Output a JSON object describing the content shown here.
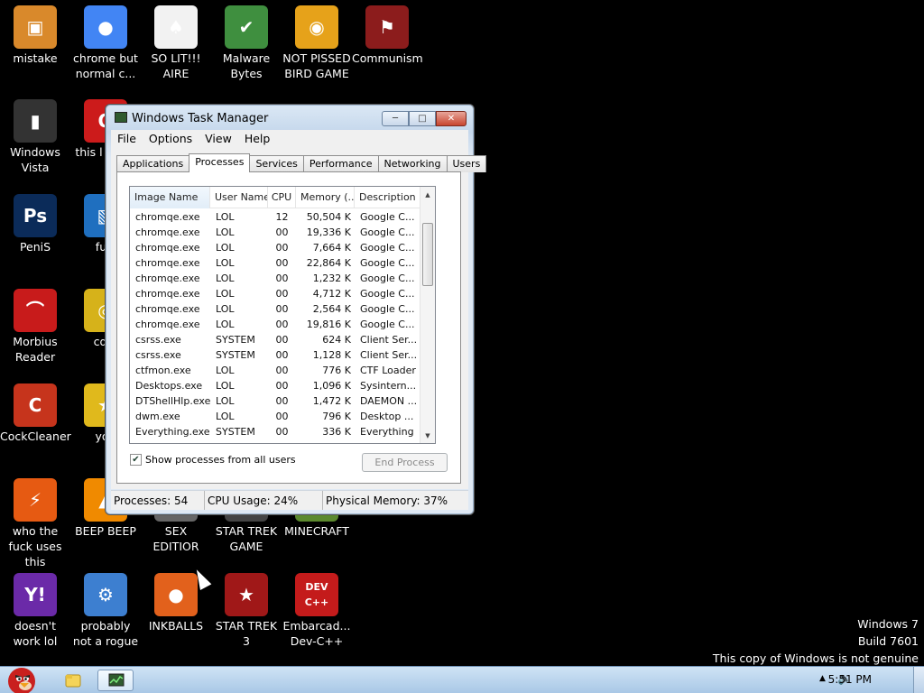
{
  "desktop": {
    "icons": [
      {
        "label": "mistake",
        "icon": "computer-icon",
        "color": "#d9892b",
        "glyph": "▣"
      },
      {
        "label": "chrome but normal c...",
        "icon": "chrome-icon",
        "color": "#4285f4",
        "glyph": "●"
      },
      {
        "label": "SO LIT!!! AIRE",
        "icon": "cards-icon",
        "color": "#f2f2f2",
        "glyph": "♠"
      },
      {
        "label": "Malware Bytes",
        "icon": "shield-icon",
        "color": "#3f8f3f",
        "glyph": "✔"
      },
      {
        "label": "NOT PISSED BIRD GAME",
        "icon": "pig-icon",
        "color": "#e6a21a",
        "glyph": "◉"
      },
      {
        "label": "Communism",
        "icon": "flag-icon",
        "color": "#8c1c1c",
        "glyph": "⚑"
      },
      {
        "label": "Windows Vista",
        "icon": "trash-icon",
        "color": "#333333",
        "glyph": "▮"
      },
      {
        "label": "this l like a",
        "icon": "opera-icon",
        "color": "#cc1b1b",
        "glyph": "O"
      },
      {
        "label": "PeniS",
        "icon": "photoshop-icon",
        "color": "#0b2b59",
        "glyph": "Ps"
      },
      {
        "label": "furr",
        "icon": "app-icon",
        "color": "#1f6fbf",
        "glyph": "▧"
      },
      {
        "label": "Morbius Reader",
        "icon": "pdf-icon",
        "color": "#c81b1b",
        "glyph": "⌒"
      },
      {
        "label": "cd d",
        "icon": "disc-icon",
        "color": "#d6b21a",
        "glyph": "◎"
      },
      {
        "label": "CockCleaner",
        "icon": "broom-icon",
        "color": "#c6341c",
        "glyph": "C"
      },
      {
        "label": "you",
        "icon": "star-icon",
        "color": "#e0b91c",
        "glyph": "★"
      },
      {
        "label": "who the fuck uses this",
        "icon": "lightning-icon",
        "color": "#e65a12",
        "glyph": "⚡"
      },
      {
        "label": "BEEP BEEP",
        "icon": "vlc-icon",
        "color": "#f08a00",
        "glyph": "▲"
      },
      {
        "label": "SEX EDITIOR",
        "icon": "editor-icon",
        "color": "#666666",
        "glyph": "▤"
      },
      {
        "label": "STAR TREK GAME",
        "icon": "game-icon",
        "color": "#444444",
        "glyph": "▤"
      },
      {
        "label": "MINECRAFT",
        "icon": "minecraft-icon",
        "color": "#5c8a2e",
        "glyph": "▦"
      },
      {
        "label": "doesn't work lol",
        "icon": "yahoo-icon",
        "color": "#6b2aa8",
        "glyph": "Y!"
      },
      {
        "label": "probably not a rogue",
        "icon": "gears-icon",
        "color": "#3d7fd0",
        "glyph": "⚙"
      },
      {
        "label": "INKBALLS",
        "icon": "inkball-icon",
        "color": "#e2611c",
        "glyph": "●"
      },
      {
        "label": "STAR TREK 3",
        "icon": "starwars-icon",
        "color": "#a01818",
        "glyph": "★"
      },
      {
        "label": "Embarcad... Dev-C++",
        "icon": "devcpp-icon",
        "color": "#c41b1b",
        "glyph": "DEV C++"
      }
    ],
    "watermark": {
      "line1": "Windows 7",
      "line2": "Build 7601",
      "line3": "This copy of Windows is not genuine"
    }
  },
  "window": {
    "title": "Windows Task Manager",
    "menu": [
      "File",
      "Options",
      "View",
      "Help"
    ],
    "tabs": [
      "Applications",
      "Processes",
      "Services",
      "Performance",
      "Networking",
      "Users"
    ],
    "selected_tab": "Processes",
    "columns": [
      "Image Name",
      "User Name",
      "CPU",
      "Memory (...",
      "Description"
    ],
    "rows": [
      [
        "chromqe.exe",
        "LOL",
        "12",
        "50,504 K",
        "Google C..."
      ],
      [
        "chromqe.exe",
        "LOL",
        "00",
        "19,336 K",
        "Google C..."
      ],
      [
        "chromqe.exe",
        "LOL",
        "00",
        "7,664 K",
        "Google C..."
      ],
      [
        "chromqe.exe",
        "LOL",
        "00",
        "22,864 K",
        "Google C..."
      ],
      [
        "chromqe.exe",
        "LOL",
        "00",
        "1,232 K",
        "Google C..."
      ],
      [
        "chromqe.exe",
        "LOL",
        "00",
        "4,712 K",
        "Google C..."
      ],
      [
        "chromqe.exe",
        "LOL",
        "00",
        "2,564 K",
        "Google C..."
      ],
      [
        "chromqe.exe",
        "LOL",
        "00",
        "19,816 K",
        "Google C..."
      ],
      [
        "csrss.exe",
        "SYSTEM",
        "00",
        "624 K",
        "Client Ser..."
      ],
      [
        "csrss.exe",
        "SYSTEM",
        "00",
        "1,128 K",
        "Client Ser..."
      ],
      [
        "ctfmon.exe",
        "LOL",
        "00",
        "776 K",
        "CTF Loader"
      ],
      [
        "Desktops.exe",
        "LOL",
        "00",
        "1,096 K",
        "Sysintern..."
      ],
      [
        "DTShellHlp.exe",
        "LOL",
        "00",
        "1,472 K",
        "DAEMON ..."
      ],
      [
        "dwm.exe",
        "LOL",
        "00",
        "796 K",
        "Desktop ..."
      ],
      [
        "Everything.exe",
        "SYSTEM",
        "00",
        "336 K",
        "Everything"
      ]
    ],
    "show_all_label": "Show processes from all users",
    "show_all_checked": "✔",
    "end_process_label": "End Process",
    "status": {
      "processes": "Processes: 54",
      "cpu": "CPU Usage: 24%",
      "memory": "Physical Memory: 37%"
    }
  },
  "taskbar": {
    "clock": "5:51 PM"
  }
}
